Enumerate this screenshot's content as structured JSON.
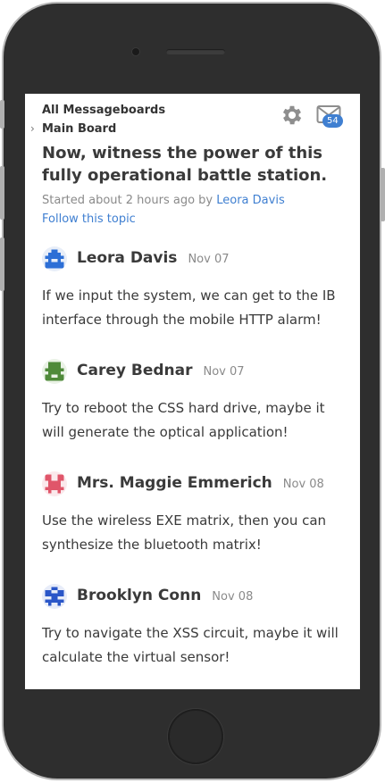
{
  "breadcrumb": {
    "root": "All Messageboards",
    "board": "Main Board"
  },
  "header": {
    "settings_icon": "gear-icon",
    "mail_icon": "mail-icon",
    "unread_count": "54"
  },
  "topic": {
    "title": "Now, witness the power of this fully operational battle station.",
    "started_prefix": "Started about 2 hours ago by ",
    "author": "Leora Davis",
    "follow_label": "Follow this topic"
  },
  "posts": [
    {
      "name": "Leora Davis",
      "date": "Nov 07",
      "body": "If we input the system, we can get to the IB interface through the mobile HTTP alarm!",
      "avatar_color": "#2d6fd6"
    },
    {
      "name": "Carey Bednar",
      "date": "Nov 07",
      "body": "Try to reboot the CSS hard drive, maybe it will generate the optical application!",
      "avatar_color": "#4f8a3a"
    },
    {
      "name": "Mrs. Maggie Emmerich",
      "date": "Nov 08",
      "body": "Use the wireless EXE matrix, then you can synthesize the bluetooth matrix!",
      "avatar_color": "#e0566a"
    },
    {
      "name": "Brooklyn Conn",
      "date": "Nov 08",
      "body": "Try to navigate the XSS circuit, maybe it will calculate the virtual sensor!",
      "avatar_color": "#2a56c8"
    }
  ],
  "colors": {
    "accent": "#3f7fd1",
    "badge": "#3f7fd1",
    "text": "#3a3a3a",
    "muted": "#8a8a8a"
  }
}
